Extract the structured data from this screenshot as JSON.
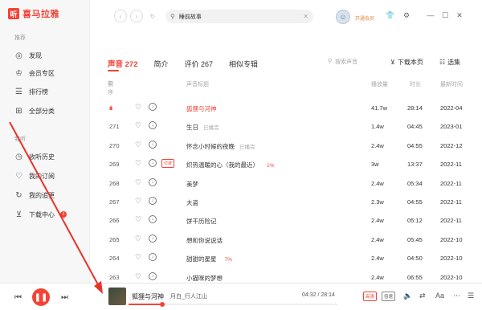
{
  "app": {
    "logo_char": "听",
    "logo_text": "喜马拉雅",
    "accent": "#f44336"
  },
  "sidebar": {
    "section_recommend": "推荐",
    "section_mine": "我听",
    "items": [
      {
        "label": "发现",
        "icon": "compass-icon"
      },
      {
        "label": "会员专区",
        "icon": "crown-icon"
      },
      {
        "label": "排行榜",
        "icon": "ranking-icon"
      },
      {
        "label": "全部分类",
        "icon": "grid-icon"
      },
      {
        "label": "收听历史",
        "icon": "clock-icon"
      },
      {
        "label": "我的订阅",
        "icon": "heart-icon"
      },
      {
        "label": "我的追更",
        "icon": "refresh-icon"
      },
      {
        "label": "下载中心",
        "icon": "download-icon",
        "badge": "1"
      }
    ]
  },
  "topbar": {
    "search_value": "睡前故事",
    "vip_label": "开通会员"
  },
  "tabs": [
    {
      "label": "声音 272",
      "active": true
    },
    {
      "label": "简介",
      "active": false
    },
    {
      "label": "评价 267",
      "active": false
    },
    {
      "label": "相似专辑",
      "active": false
    }
  ],
  "toolbar": {
    "search_placeholder": "搜索声音",
    "download_page": "下载本页",
    "select": "选集"
  },
  "table": {
    "headers": {
      "order": "倒序",
      "title": "声音标题",
      "plays": "播放量",
      "duration": "时长",
      "updated": "最新时间"
    },
    "rows": [
      {
        "index": "",
        "playing": true,
        "title": "狐狸与河神",
        "tag": "",
        "tag_red": "",
        "paid": "",
        "plays": "41.7w",
        "duration": "28:14",
        "date": "2022-04"
      },
      {
        "index": "271",
        "playing": false,
        "title": "生日",
        "tag": "已播完",
        "tag_red": "",
        "paid": "",
        "plays": "1.4w",
        "duration": "04:45",
        "date": "2023-01"
      },
      {
        "index": "270",
        "playing": false,
        "title": "怀念小时候的夜晚",
        "tag": "已播完",
        "tag_red": "",
        "paid": "",
        "plays": "2.4w",
        "duration": "04:55",
        "date": "2022-12"
      },
      {
        "index": "269",
        "playing": false,
        "title": "炽热温暖的心（我的最近）",
        "tag": "",
        "tag_red": "1%",
        "paid": "付费",
        "plays": "3w",
        "duration": "13:37",
        "date": "2022-11"
      },
      {
        "index": "268",
        "playing": false,
        "title": "美梦",
        "tag": "",
        "tag_red": "",
        "paid": "",
        "plays": "2.4w",
        "duration": "05:34",
        "date": "2022-11"
      },
      {
        "index": "267",
        "playing": false,
        "title": "大盗",
        "tag": "",
        "tag_red": "",
        "paid": "",
        "plays": "2.3w",
        "duration": "04:55",
        "date": "2022-11"
      },
      {
        "index": "266",
        "playing": false,
        "title": "饼干历险记",
        "tag": "",
        "tag_red": "",
        "paid": "",
        "plays": "2.4w",
        "duration": "05:12",
        "date": "2022-11"
      },
      {
        "index": "265",
        "playing": false,
        "title": "想和你说说话",
        "tag": "",
        "tag_red": "",
        "paid": "",
        "plays": "2.4w",
        "duration": "05:45",
        "date": "2022-10"
      },
      {
        "index": "264",
        "playing": false,
        "title": "甜甜的星星",
        "tag": "",
        "tag_red": "7%",
        "paid": "",
        "plays": "2.4w",
        "duration": "04:50",
        "date": "2022-10"
      },
      {
        "index": "263",
        "playing": false,
        "title": "小猫咪的梦想",
        "tag": "",
        "tag_red": "",
        "paid": "",
        "plays": "2.4w",
        "duration": "06:55",
        "date": "2022-10"
      }
    ]
  },
  "player": {
    "title": "狐狸与河神",
    "album": "月白_行人江山",
    "time": "04:32 / 28:14",
    "progress_fraction": 0.16,
    "quality_tag": "高清",
    "speed_tag": "倍速"
  }
}
